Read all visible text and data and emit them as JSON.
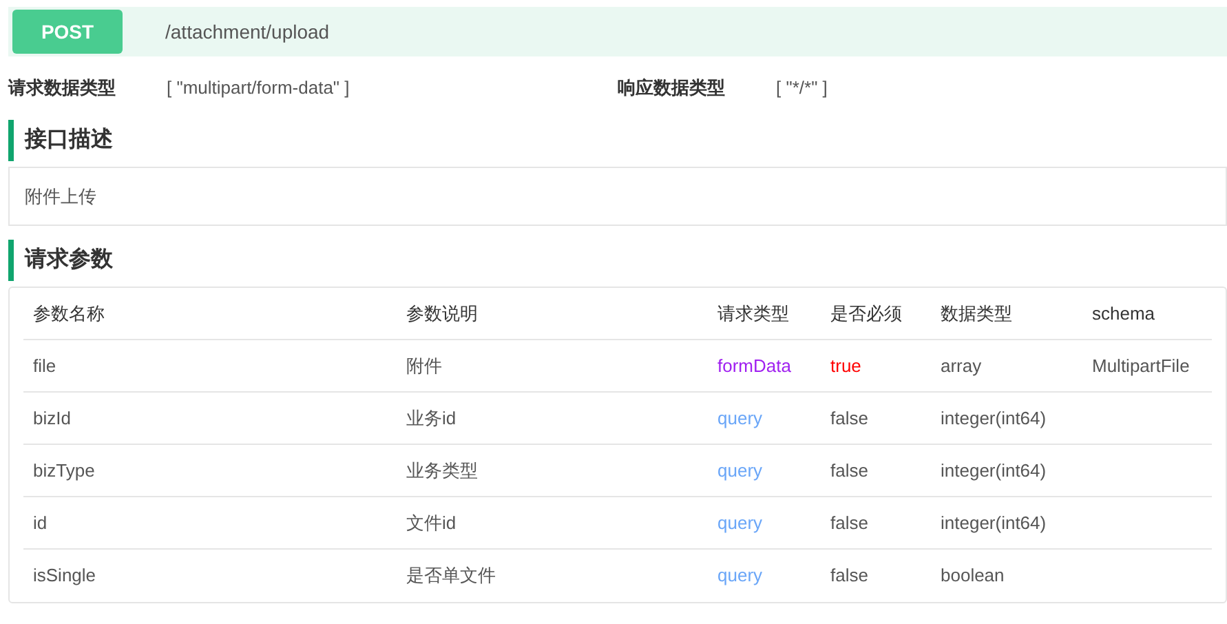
{
  "endpoint": {
    "method": "POST",
    "path": "/attachment/upload"
  },
  "content_types": [
    {
      "label": "请求数据类型",
      "value": "[ \"multipart/form-data\" ]"
    },
    {
      "label": "响应数据类型",
      "value": "[ \"*/*\" ]"
    }
  ],
  "description": {
    "title": "接口描述",
    "text": "附件上传"
  },
  "parameters": {
    "title": "请求参数",
    "columns": [
      "参数名称",
      "参数说明",
      "请求类型",
      "是否必须",
      "数据类型",
      "schema"
    ],
    "rows": [
      {
        "name": "file",
        "desc": "附件",
        "in": {
          "text": "formData",
          "kind": "form"
        },
        "required": {
          "text": "true",
          "highlight": true
        },
        "type": "array",
        "schema": "MultipartFile"
      },
      {
        "name": "bizId",
        "desc": "业务id",
        "in": {
          "text": "query",
          "kind": "query"
        },
        "required": {
          "text": "false",
          "highlight": false
        },
        "type": "integer(int64)"
      },
      {
        "name": "bizType",
        "desc": "业务类型",
        "in": {
          "text": "query",
          "kind": "query"
        },
        "required": {
          "text": "false",
          "highlight": false
        },
        "type": "integer(int64)"
      },
      {
        "name": "id",
        "desc": "文件id",
        "in": {
          "text": "query",
          "kind": "query"
        },
        "required": {
          "text": "false",
          "highlight": false
        },
        "type": "integer(int64)"
      },
      {
        "name": "isSingle",
        "desc": "是否单文件",
        "in": {
          "text": "query",
          "kind": "query"
        },
        "required": {
          "text": "false",
          "highlight": false
        },
        "type": "boolean"
      }
    ]
  }
}
